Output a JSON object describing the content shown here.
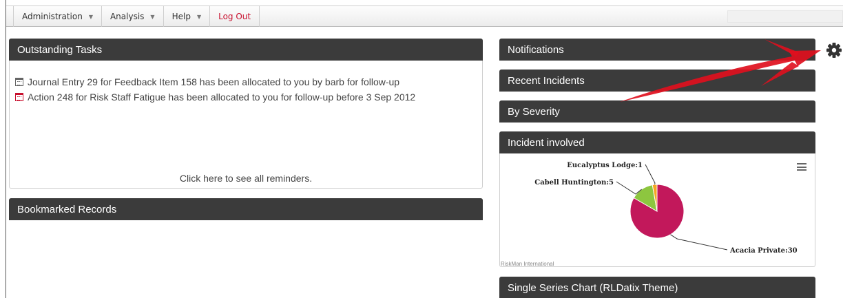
{
  "menu": {
    "items": [
      {
        "label": "Administration",
        "has_caret": true
      },
      {
        "label": "Analysis",
        "has_caret": true
      },
      {
        "label": "Help",
        "has_caret": true
      },
      {
        "label": "Log Out",
        "has_caret": false
      }
    ]
  },
  "panels": {
    "outstanding_tasks": {
      "title": "Outstanding Tasks",
      "tasks": [
        {
          "text": "Journal Entry 29 for Feedback Item 158 has been allocated to you by barb for follow-up",
          "icon": "calendar-icon"
        },
        {
          "text": "Action 248 for Risk Staff Fatigue has been allocated to you for follow-up before 3 Sep 2012",
          "icon": "calendar-icon"
        }
      ],
      "link": "Click here to see all reminders."
    },
    "bookmarked": {
      "title": "Bookmarked Records"
    },
    "notifications": {
      "title": "Notifications"
    },
    "recent_incidents": {
      "title": "Recent Incidents"
    },
    "by_severity": {
      "title": "By Severity"
    },
    "incident_involved": {
      "title": "Incident involved",
      "credit": "RiskMan International"
    },
    "single_series": {
      "title": "Single Series Chart (RLDatix Theme)"
    }
  },
  "chart_data": {
    "type": "pie",
    "title": "",
    "slices": [
      {
        "name": "Acacia Private",
        "value": 30,
        "color": "#c2185b"
      },
      {
        "name": "Cabell Huntington",
        "value": 5,
        "color": "#8dc63f"
      },
      {
        "name": "Eucalyptus Lodge",
        "value": 1,
        "color": "#f5a623"
      }
    ],
    "labels": [
      "Acacia Private:30",
      "Cabell Huntington:5",
      "Eucalyptus Lodge:1"
    ]
  },
  "colors": {
    "header": "#3b3b3b",
    "logout": "#c8102e",
    "annotation_arrow": "#e0101e"
  },
  "icons": [
    "calendar-icon",
    "gear-icon",
    "menu-lines-icon",
    "caret-down-icon"
  ]
}
